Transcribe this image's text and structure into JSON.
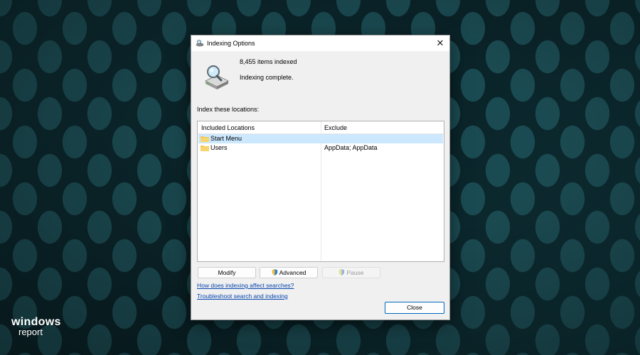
{
  "watermark": {
    "line1": "windows",
    "line2": "report"
  },
  "dialog": {
    "title": "Indexing Options",
    "items_indexed": "8,455 items indexed",
    "status": "Indexing complete.",
    "index_label": "Index these locations:",
    "columns": {
      "included": "Included Locations",
      "exclude": "Exclude"
    },
    "rows": [
      {
        "location": "Start Menu",
        "exclude": "",
        "selected": true
      },
      {
        "location": "Users",
        "exclude": "AppData; AppData",
        "selected": false
      }
    ],
    "buttons": {
      "modify": "Modify",
      "advanced": "Advanced",
      "pause": "Pause",
      "close": "Close"
    },
    "links": {
      "how": "How does indexing affect searches?",
      "troubleshoot": "Troubleshoot search and indexing"
    }
  },
  "icons": [
    "indexing-options-icon",
    "close-icon",
    "drive-search-icon",
    "folder-icon",
    "shield-icon"
  ],
  "colors": {
    "selection": "#cce8ff",
    "link": "#0645ad",
    "folder": "#f3c454",
    "accent": "#0067c0"
  }
}
